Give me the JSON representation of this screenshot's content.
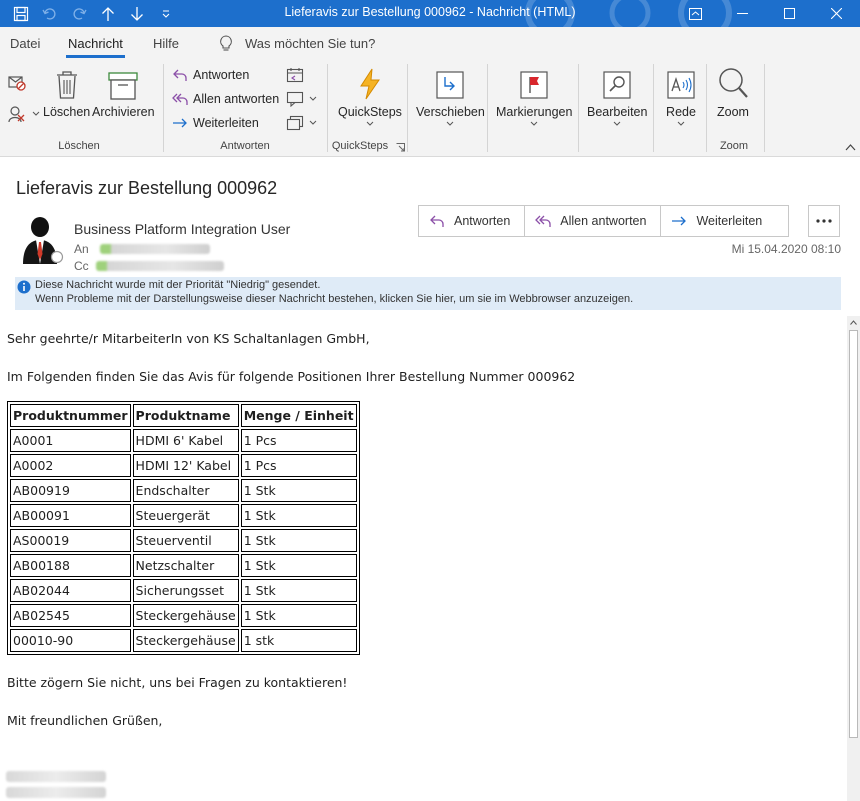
{
  "window": {
    "title": "Lieferavis zur Bestellung 000962  -  Nachricht (HTML)",
    "accent": "#1d6fcc"
  },
  "tabs": [
    {
      "label": "Datei"
    },
    {
      "label": "Nachricht",
      "active": true
    },
    {
      "label": "Hilfe"
    }
  ],
  "tell_me": {
    "placeholder": "Was möchten Sie tun?"
  },
  "ribbon": {
    "loeschen": {
      "delete_label": "Löschen",
      "archive_label": "Archivieren",
      "group_label": "Löschen"
    },
    "antworten": {
      "reply_label": "Antworten",
      "reply_all_label": "Allen antworten",
      "forward_label": "Weiterleiten",
      "group_label": "Antworten"
    },
    "quicksteps": {
      "label": "QuickSteps",
      "group_label": "QuickSteps"
    },
    "verschieben": {
      "label": "Verschieben"
    },
    "markierungen": {
      "label": "Markierungen"
    },
    "bearbeiten": {
      "label": "Bearbeiten"
    },
    "rede": {
      "label": "Rede"
    },
    "zoom": {
      "label": "Zoom",
      "group_label": "Zoom"
    }
  },
  "message": {
    "subject": "Lieferavis zur Bestellung 000962",
    "sender": "Business Platform Integration User",
    "to_label": "An",
    "cc_label": "Cc",
    "timestamp": "Mi 15.04.2020 08:10",
    "actions": {
      "reply": "Antworten",
      "reply_all": "Allen antworten",
      "forward": "Weiterleiten"
    },
    "info_lines": [
      "Diese Nachricht wurde mit der Priorität \"Niedrig\" gesendet.",
      "Wenn Probleme mit der Darstellungsweise dieser Nachricht bestehen, klicken Sie hier, um sie im Webbrowser anzuzeigen."
    ],
    "greeting": "Sehr geehrte/r MitarbeiterIn von KS Schaltanlagen GmbH,",
    "intro": "Im Folgenden finden Sie das Avis für folgende Positionen Ihrer Bestellung Nummer 000962",
    "table": {
      "headers": [
        "Produktnummer",
        "Produktname",
        "Menge / Einheit"
      ],
      "rows": [
        [
          "A0001",
          "HDMI 6' Kabel",
          "1 Pcs"
        ],
        [
          "A0002",
          "HDMI 12' Kabel",
          "1 Pcs"
        ],
        [
          "AB00919",
          "Endschalter",
          "1 Stk"
        ],
        [
          "AB00091",
          "Steuergerät",
          "1 Stk"
        ],
        [
          "AS00019",
          "Steuerventil",
          "1 Stk"
        ],
        [
          "AB00188",
          "Netzschalter",
          "1 Stk"
        ],
        [
          "AB02044",
          "Sicherungsset",
          "1 Stk"
        ],
        [
          "AB02545",
          "Steckergehäuse",
          "1 Stk"
        ],
        [
          "00010-90",
          "Steckergehäuse",
          "1 stk"
        ]
      ]
    },
    "closing1": "Bitte zögern Sie nicht, uns bei Fragen zu kontaktieren!",
    "closing2": "Mit freundlichen Grüßen,"
  }
}
